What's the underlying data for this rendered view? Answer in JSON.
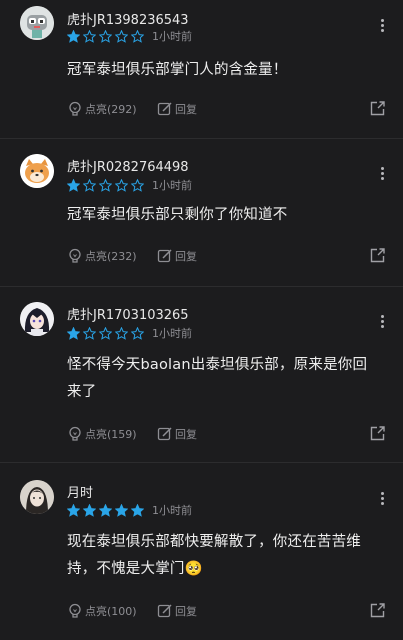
{
  "colors": {
    "star_filled": "#2aa5e8",
    "star_empty": "#2aa5e8",
    "background": "#1c1c1e"
  },
  "comments": [
    {
      "username": "虎扑JR1398236543",
      "rating": 1,
      "time": "1小时前",
      "text_lines": [
        "冠军泰坦俱乐部掌门人的含金量！"
      ],
      "likes_label": "点亮",
      "likes_count": "(292)",
      "reply_label": "回复",
      "avatar": "robot-avatar-icon"
    },
    {
      "username": "虎扑JR0282764498",
      "rating": 1,
      "time": "1小时前",
      "text_lines": [
        "冠军泰坦俱乐部只剩你了你知道不"
      ],
      "likes_label": "点亮",
      "likes_count": "(232)",
      "reply_label": "回复",
      "avatar": "shiba-dog-avatar-icon"
    },
    {
      "username": "虎扑JR1703103265",
      "rating": 1,
      "time": "1小时前",
      "text_lines": [
        "怪不得今天baolan出泰坦俱乐部，原来是你回",
        "来了"
      ],
      "likes_label": "点亮",
      "likes_count": "(159)",
      "reply_label": "回复",
      "avatar": "anime-character-avatar-icon"
    },
    {
      "username": "月时",
      "rating": 5,
      "time": "1小时前",
      "text_lines": [
        "现在泰坦俱乐部都快要解散了，你还在苦苦维",
        "持，不愧是大掌门🥺"
      ],
      "likes_label": "点亮",
      "likes_count": "(100)",
      "reply_label": "回复",
      "avatar": "person-photo-avatar-icon"
    }
  ]
}
